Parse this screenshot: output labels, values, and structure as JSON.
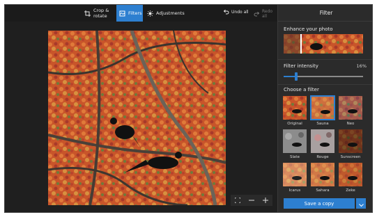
{
  "toolbar": {
    "tabs": [
      {
        "label": "Crop & rotate",
        "icon": "crop-icon"
      },
      {
        "label": "Filters",
        "icon": "filters-icon",
        "active": true
      },
      {
        "label": "Adjustments",
        "icon": "brightness-icon"
      }
    ],
    "undo_all": "Undo all",
    "redo_all": "Redo all"
  },
  "panel": {
    "title": "Filter",
    "enhance_label": "Enhance your photo",
    "intensity_label": "Filter intensity",
    "intensity_value": "16%",
    "intensity_fraction": 0.16,
    "choose_label": "Choose a filter",
    "filters": [
      "Original",
      "Sauna",
      "Neo",
      "Slate",
      "Rouge",
      "Sunscreen",
      "Icarus",
      "Sahara",
      "Zeke"
    ],
    "selected_filter": "Sauna",
    "save_label": "Save a copy"
  },
  "colors": {
    "accent": "#2d7fd0",
    "panel_bg": "#2b2b2b",
    "app_bg": "#1b1b1b"
  }
}
